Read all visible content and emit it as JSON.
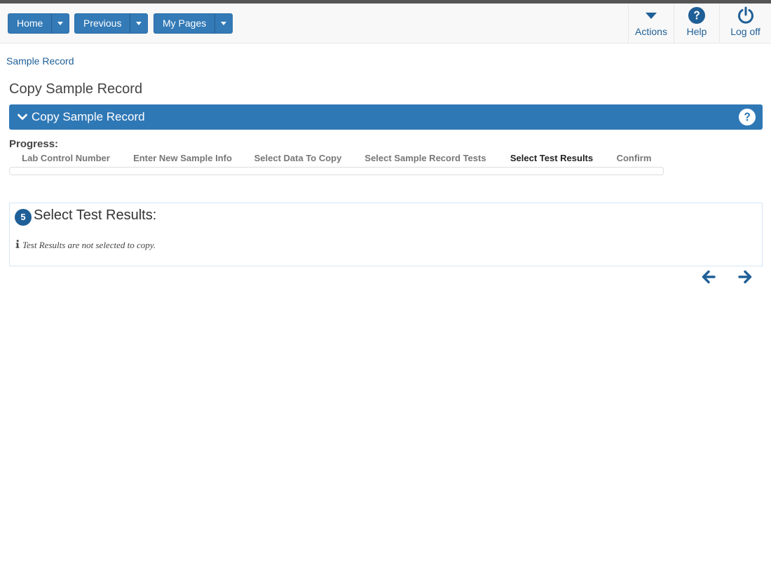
{
  "topbar": {
    "nav_buttons": [
      {
        "label": "Home"
      },
      {
        "label": "Previous"
      },
      {
        "label": "My Pages"
      }
    ],
    "right_nav": [
      {
        "label": "Actions",
        "icon": "caret-down-icon"
      },
      {
        "label": "Help",
        "icon": "question-circle-icon"
      },
      {
        "label": "Log off",
        "icon": "power-icon"
      }
    ]
  },
  "breadcrumb": "Sample Record",
  "page_title": "Copy Sample Record",
  "panel": {
    "header_title": "Copy Sample Record",
    "header_icon": "chevron-down-icon",
    "help_icon": "question-circle-icon"
  },
  "progress": {
    "label": "Progress:",
    "steps": [
      {
        "label": "Lab Control Number",
        "active": false
      },
      {
        "label": "Enter New Sample Info",
        "active": false
      },
      {
        "label": "Select Data To Copy",
        "active": false
      },
      {
        "label": "Select Sample Record Tests",
        "active": false
      },
      {
        "label": "Select Test Results",
        "active": true
      },
      {
        "label": "Confirm",
        "active": false
      }
    ],
    "fill": 0
  },
  "wizard": {
    "step_number": "5",
    "section_title": "Select Test Results:",
    "info_icon": "info-icon",
    "info_text": "Test Results are not selected to copy."
  },
  "navigation": {
    "back_icon": "arrow-left-icon",
    "next_icon": "arrow-right-icon"
  },
  "colors": {
    "primary": "#337ab7",
    "header_blue": "#2f78b6",
    "link": "#1f5f97"
  }
}
